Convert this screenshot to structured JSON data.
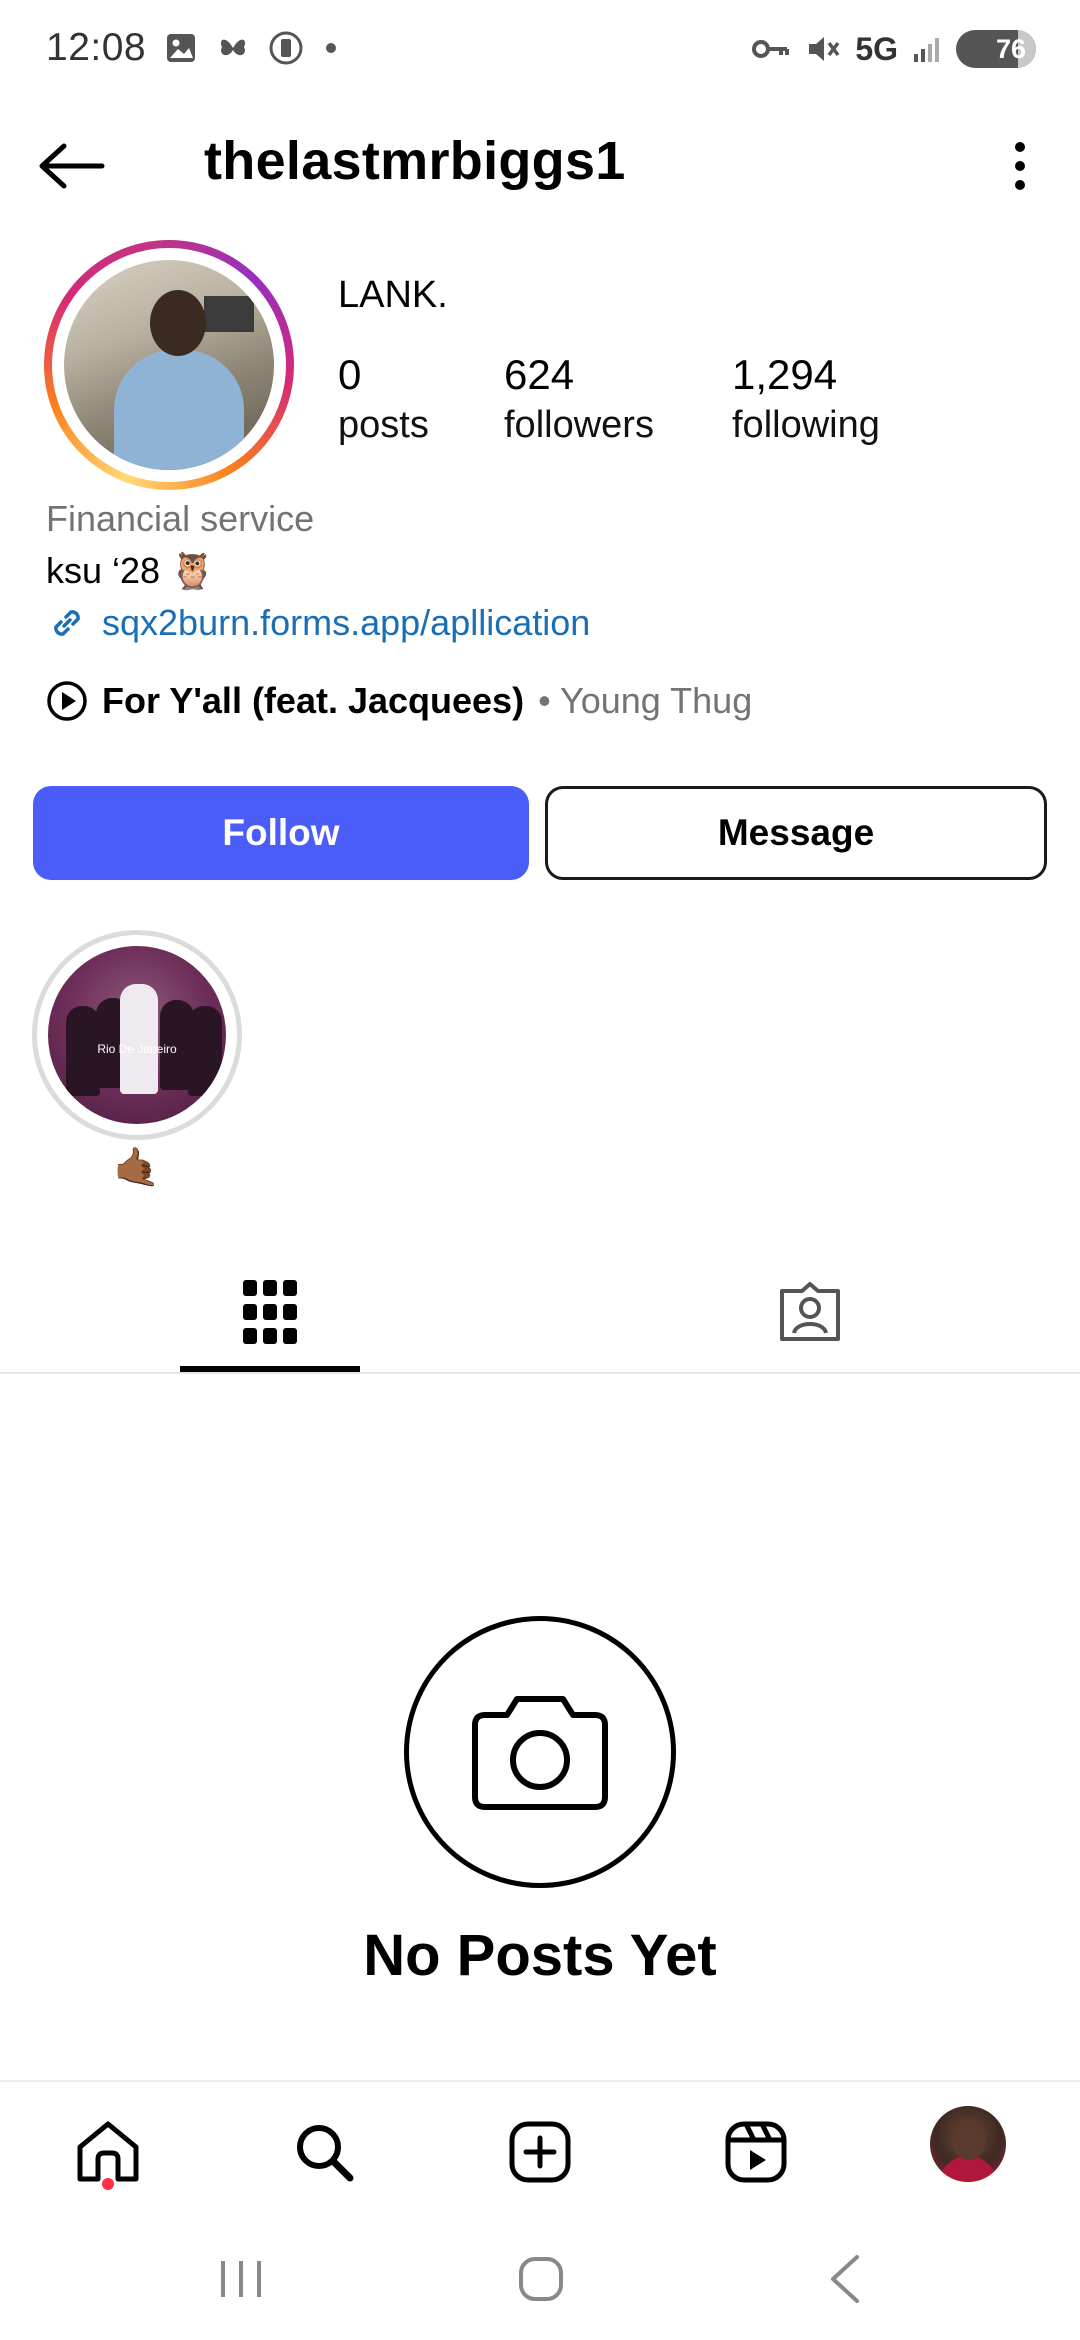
{
  "status_bar": {
    "time": "12:08",
    "network": "5G",
    "battery": "76"
  },
  "header": {
    "username": "thelastmrbiggs1"
  },
  "profile": {
    "display_name": "LANK.",
    "stats": [
      {
        "value": "0",
        "label": "posts"
      },
      {
        "value": "624",
        "label": "followers"
      },
      {
        "value": "1,294",
        "label": "following"
      }
    ],
    "category": "Financial service",
    "bio": "ksu ‘28 🦉",
    "link": "sqx2burn.forms.app/apllication",
    "music": {
      "title": "For Y'all (feat. Jacquees)",
      "artist": "• Young Thug"
    }
  },
  "actions": {
    "follow": "Follow",
    "message": "Message"
  },
  "highlights": [
    {
      "label": "🤙🏾",
      "caption": "Rio De Janeiro"
    }
  ],
  "empty_state": {
    "title": "No Posts Yet"
  },
  "colors": {
    "follow_button": "#4a5df9",
    "link": "#1a6fb4",
    "secondary_text": "#737373",
    "notification_dot": "#ff3040"
  }
}
